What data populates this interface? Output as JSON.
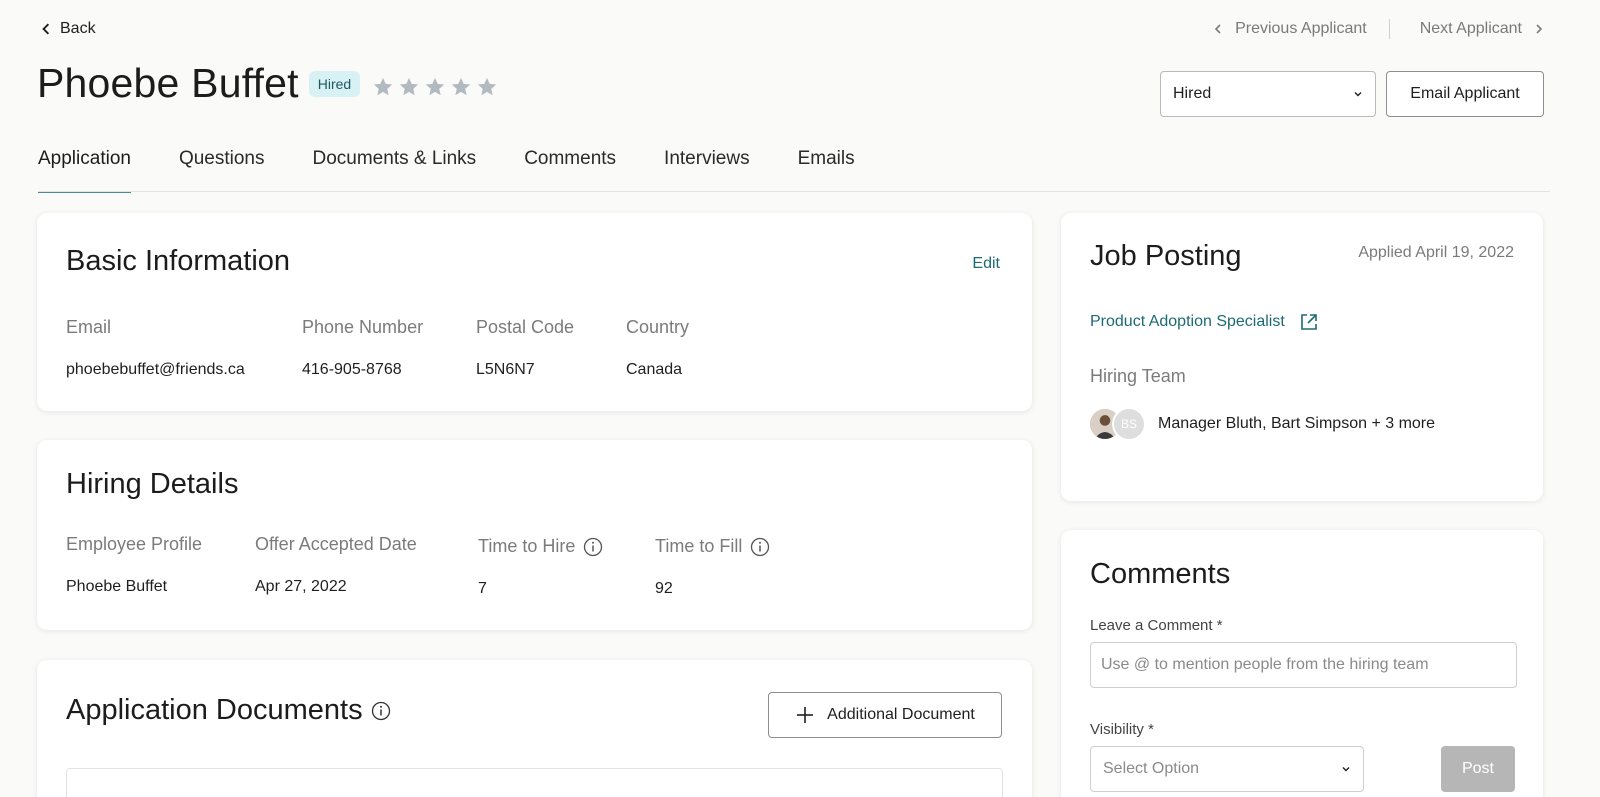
{
  "header": {
    "back_label": "Back",
    "prev_label": "Previous Applicant",
    "next_label": "Next Applicant"
  },
  "applicant": {
    "name": "Phoebe Buffet",
    "status_badge": "Hired",
    "rating": 0,
    "max_rating": 5,
    "status_select_value": "Hired",
    "email_button": "Email Applicant"
  },
  "tabs": [
    {
      "label": "Application",
      "active": true
    },
    {
      "label": "Questions",
      "active": false
    },
    {
      "label": "Documents & Links",
      "active": false
    },
    {
      "label": "Comments",
      "active": false
    },
    {
      "label": "Interviews",
      "active": false
    },
    {
      "label": "Emails",
      "active": false
    }
  ],
  "basic_info": {
    "title": "Basic Information",
    "edit_label": "Edit",
    "fields": [
      {
        "label": "Email",
        "value": "phoebebuffet@friends.ca"
      },
      {
        "label": "Phone Number",
        "value": "416-905-8768"
      },
      {
        "label": "Postal Code",
        "value": "L5N6N7"
      },
      {
        "label": "Country",
        "value": "Canada"
      }
    ]
  },
  "hiring_details": {
    "title": "Hiring Details",
    "fields": [
      {
        "label": "Employee Profile",
        "value": "Phoebe Buffet"
      },
      {
        "label": "Offer Accepted Date",
        "value": "Apr 27, 2022"
      },
      {
        "label": "Time to Hire",
        "value": "7"
      },
      {
        "label": "Time to Fill",
        "value": "92"
      }
    ]
  },
  "app_docs": {
    "title": "Application Documents",
    "add_button": "Additional Document"
  },
  "job_posting": {
    "title": "Job Posting",
    "applied": "Applied April 19, 2022",
    "job_link": "Product Adoption Specialist",
    "team_label": "Hiring Team",
    "avatar_initials": "BS",
    "team_members": "Manager Bluth, Bart Simpson + 3 more"
  },
  "comments": {
    "title": "Comments",
    "leave_label": "Leave a Comment *",
    "placeholder": "Use @ to mention people from the hiring team",
    "visibility_label": "Visibility *",
    "visibility_value": "Select Option",
    "post_label": "Post"
  },
  "colors": {
    "accent": "#1c6b74",
    "badge_bg": "#d8f1f4",
    "star": "#b3b9c1"
  }
}
